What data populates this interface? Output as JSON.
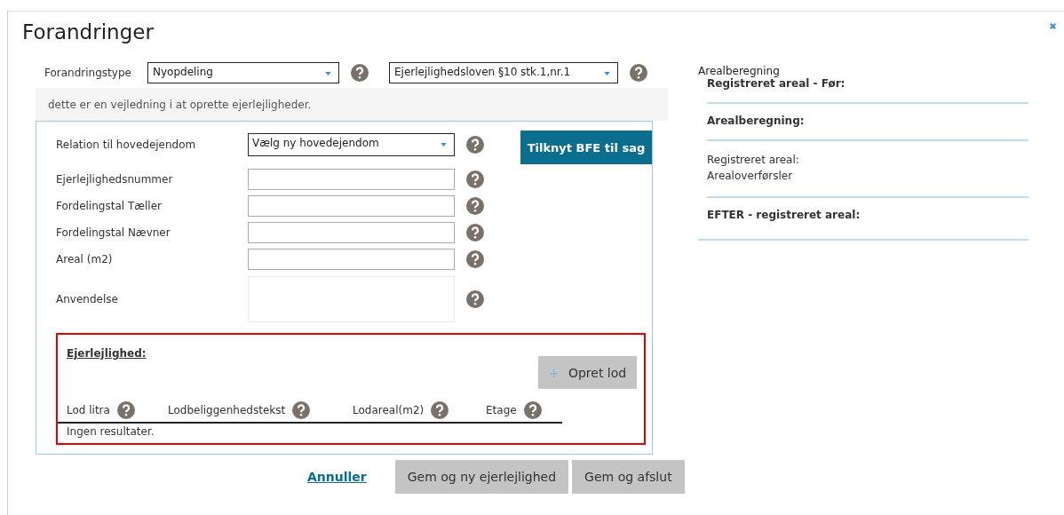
{
  "dialog": {
    "title": "Forandringer"
  },
  "type_row": {
    "label": "Forandringstype",
    "selects": [
      {
        "value": "Nyopdeling"
      },
      {
        "value": "Ejerlejlighedsloven §10 stk.1,nr.1"
      }
    ]
  },
  "guide_text": "dette er en vejledning i at oprette ejerlejligheder.",
  "form": {
    "fields": [
      {
        "label": "Relation til hovedejendom",
        "kind": "select",
        "value": "Vælg ny hovedejendom"
      },
      {
        "label": "Ejerlejlighedsnummer",
        "kind": "input"
      },
      {
        "label": "Fordelingstal Tæller",
        "kind": "input"
      },
      {
        "label": "Fordelingstal Nævner",
        "kind": "input"
      },
      {
        "label": "Areal (m2)",
        "kind": "input"
      },
      {
        "label": "Anvendelse",
        "kind": "textarea"
      }
    ],
    "link_button": "Tilknyt BFE til sag"
  },
  "unit_section": {
    "title": "Ejerlejlighed:",
    "add_button": {
      "icon": "+",
      "label": "Opret lod"
    },
    "columns": [
      "Lod litra",
      "Lodbeliggenhedstekst",
      "Lodareal(m2)",
      "Etage"
    ],
    "empty_text": "Ingen resultater."
  },
  "actions": {
    "cancel": "Annuller",
    "buttons": [
      "Gem og ny ejerlejlighed",
      "Gem og afslut"
    ]
  },
  "area_panel": {
    "title": "Arealberegning",
    "sections": [
      {
        "kind": "heading",
        "lines": [
          "Registreret areal - Før:"
        ]
      },
      {
        "kind": "heading",
        "lines": [
          "Arealberegning:"
        ]
      },
      {
        "kind": "text",
        "lines": [
          "Registreret areal:",
          "Arealoverførsler"
        ]
      },
      {
        "kind": "heading",
        "lines": [
          "EFTER - registreret areal:"
        ]
      }
    ]
  }
}
